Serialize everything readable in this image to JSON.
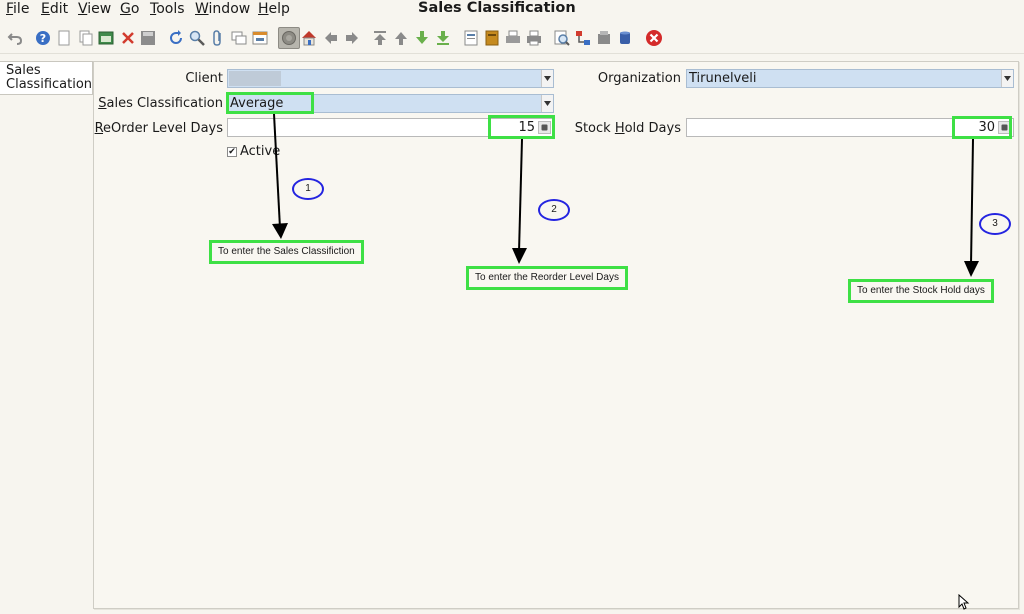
{
  "menu": {
    "items": [
      {
        "pre": "",
        "u": "F",
        "post": "ile"
      },
      {
        "pre": "",
        "u": "E",
        "post": "dit"
      },
      {
        "pre": "",
        "u": "V",
        "post": "iew"
      },
      {
        "pre": "",
        "u": "G",
        "post": "o"
      },
      {
        "pre": "",
        "u": "T",
        "post": "ools"
      },
      {
        "pre": "",
        "u": "W",
        "post": "indow"
      },
      {
        "pre": "",
        "u": "H",
        "post": "elp"
      }
    ]
  },
  "window": {
    "title": "Sales Classification"
  },
  "tabs": {
    "active": "Sales Classification"
  },
  "form": {
    "client": {
      "label": "Client",
      "value": ""
    },
    "organization": {
      "label": "Organization",
      "value": "Tirunelveli"
    },
    "sales_classification": {
      "label_u": "S",
      "label_rest": "ales Classification",
      "value": "Average"
    },
    "reorder": {
      "label_u": "R",
      "label_rest": "eOrder Level Days",
      "value": "15"
    },
    "stock_hold": {
      "label_pre": "Stock ",
      "label_u": "H",
      "label_rest": "old Days",
      "value": "30"
    },
    "active": {
      "label": "Active",
      "checked": true
    }
  },
  "annotations": {
    "numbers": [
      "1",
      "2",
      "3"
    ],
    "notes": [
      "To enter the Sales Classifiction",
      "To enter the Reorder Level Days",
      "To enter the Stock Hold days"
    ]
  },
  "icons": [
    "undo-icon",
    "help-icon",
    "new-record-icon",
    "copy-record-icon",
    "save-record-icon",
    "delete-icon",
    "disk-icon",
    "refresh-icon",
    "find-icon",
    "attachment-icon",
    "chat-icon",
    "grid-toggle-icon",
    "history-icon",
    "home-icon",
    "arrow-left-icon",
    "arrow-right-icon",
    "first-record-icon",
    "previous-record-icon",
    "next-record-icon",
    "last-record-icon",
    "report-icon",
    "archive-icon",
    "print-preview-icon",
    "print-icon",
    "zoom-across-icon",
    "workflow-icon",
    "product-info-icon",
    "database-icon",
    "exit-icon"
  ],
  "colors": {
    "highlight": "#3ee045",
    "number_circle": "#2424e0",
    "combo_bg": "#cfe0f2"
  }
}
